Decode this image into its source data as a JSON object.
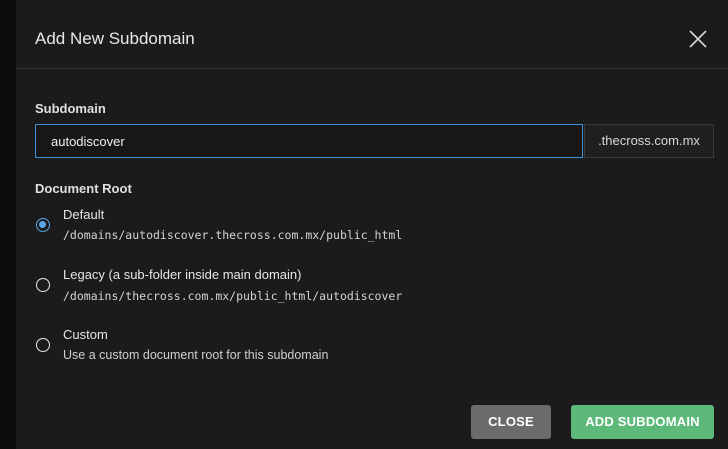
{
  "modal": {
    "title": "Add New Subdomain"
  },
  "subdomain": {
    "label": "Subdomain",
    "value": "autodiscover",
    "suffix": ".thecross.com.mx"
  },
  "document_root": {
    "label": "Document Root",
    "options": [
      {
        "title": "Default",
        "detail": "/domains/autodiscover.thecross.com.mx/public_html",
        "selected": true
      },
      {
        "title": "Legacy (a sub-folder inside main domain)",
        "detail": "/domains/thecross.com.mx/public_html/autodiscover",
        "selected": false
      },
      {
        "title": "Custom",
        "detail": "Use a custom document root for this subdomain",
        "selected": false
      }
    ]
  },
  "footer": {
    "close_label": "CLOSE",
    "add_label": "ADD SUBDOMAIN"
  },
  "colors": {
    "accent": "#5aa6e6",
    "primary_button": "#5cb97a",
    "secondary_button": "#6b6b6b"
  },
  "icons": {
    "close": "close-icon"
  }
}
